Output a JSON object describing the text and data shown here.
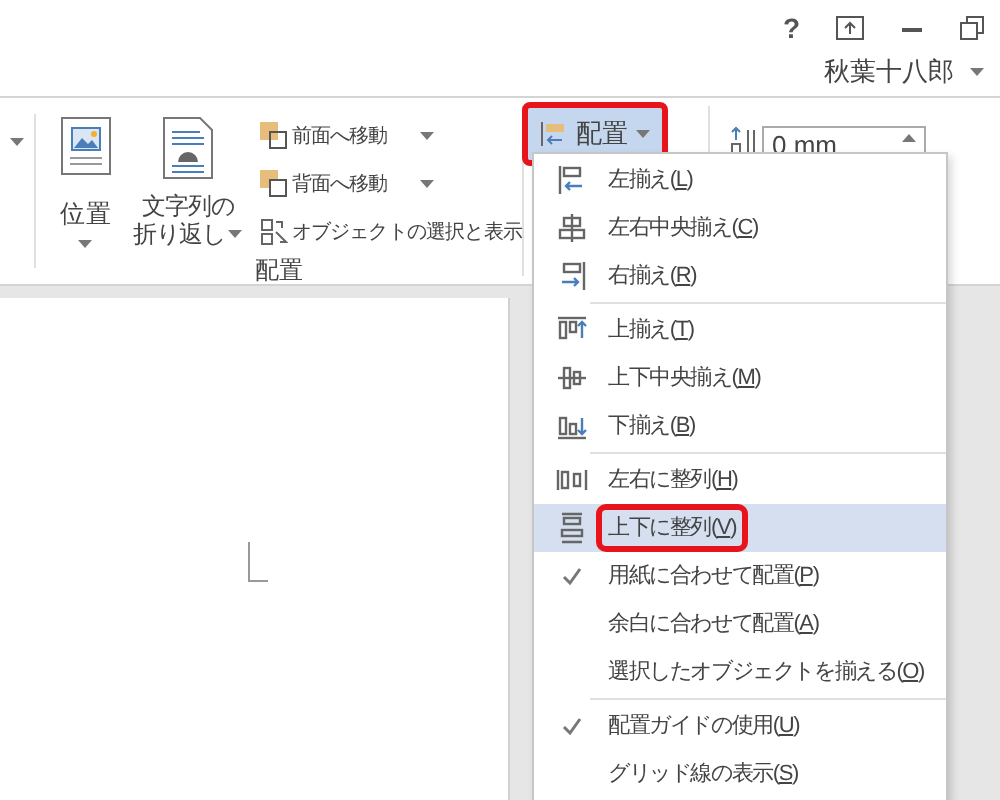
{
  "title_bar": {
    "help": "?",
    "user": "秋葉十八郎"
  },
  "ribbon": {
    "group_label": "配置",
    "large_buttons": [
      {
        "label": "位置"
      },
      {
        "lines": [
          "文字列の",
          "折り返し"
        ]
      }
    ],
    "small_buttons": [
      {
        "label": "前面へ移動",
        "dropdown": true
      },
      {
        "label": "背面へ移動",
        "dropdown": true
      },
      {
        "label": "オブジェクトの選択と表示",
        "dropdown": false
      }
    ],
    "align_button": {
      "label": "配置",
      "callout": true
    },
    "spacing_field": {
      "value": "0 mm"
    }
  },
  "menu": {
    "sections": [
      [
        {
          "text": "左揃え(",
          "key": "L",
          "tail": ")",
          "checked": false,
          "selected": false,
          "callout": false
        },
        {
          "text": "左右中央揃え(",
          "key": "C",
          "tail": ")",
          "checked": false,
          "selected": false,
          "callout": false
        },
        {
          "text": "右揃え(",
          "key": "R",
          "tail": ")",
          "checked": false,
          "selected": false,
          "callout": false
        }
      ],
      [
        {
          "text": "上揃え(",
          "key": "T",
          "tail": ")",
          "checked": false,
          "selected": false,
          "callout": false
        },
        {
          "text": "上下中央揃え(",
          "key": "M",
          "tail": ")",
          "checked": false,
          "selected": false,
          "callout": false
        },
        {
          "text": "下揃え(",
          "key": "B",
          "tail": ")",
          "checked": false,
          "selected": false,
          "callout": false
        }
      ],
      [
        {
          "text": "左右に整列(",
          "key": "H",
          "tail": ")",
          "checked": false,
          "selected": false,
          "callout": false
        },
        {
          "text": "上下に整列(",
          "key": "V",
          "tail": ")",
          "checked": false,
          "selected": true,
          "callout": true
        },
        {
          "text": "用紙に合わせて配置(",
          "key": "P",
          "tail": ")",
          "checked": true,
          "selected": false,
          "callout": false
        },
        {
          "text": "余白に合わせて配置(",
          "key": "A",
          "tail": ")",
          "checked": false,
          "selected": false,
          "callout": false
        },
        {
          "text": "選択したオブジェクトを揃える(",
          "key": "O",
          "tail": ")",
          "checked": false,
          "selected": false,
          "callout": false
        }
      ],
      [
        {
          "text": "配置ガイドの使用(",
          "key": "U",
          "tail": ")",
          "checked": true,
          "selected": false,
          "callout": false
        },
        {
          "text": "グリッド線の表示(",
          "key": "S",
          "tail": ")",
          "checked": false,
          "selected": false,
          "callout": false
        }
      ]
    ]
  }
}
